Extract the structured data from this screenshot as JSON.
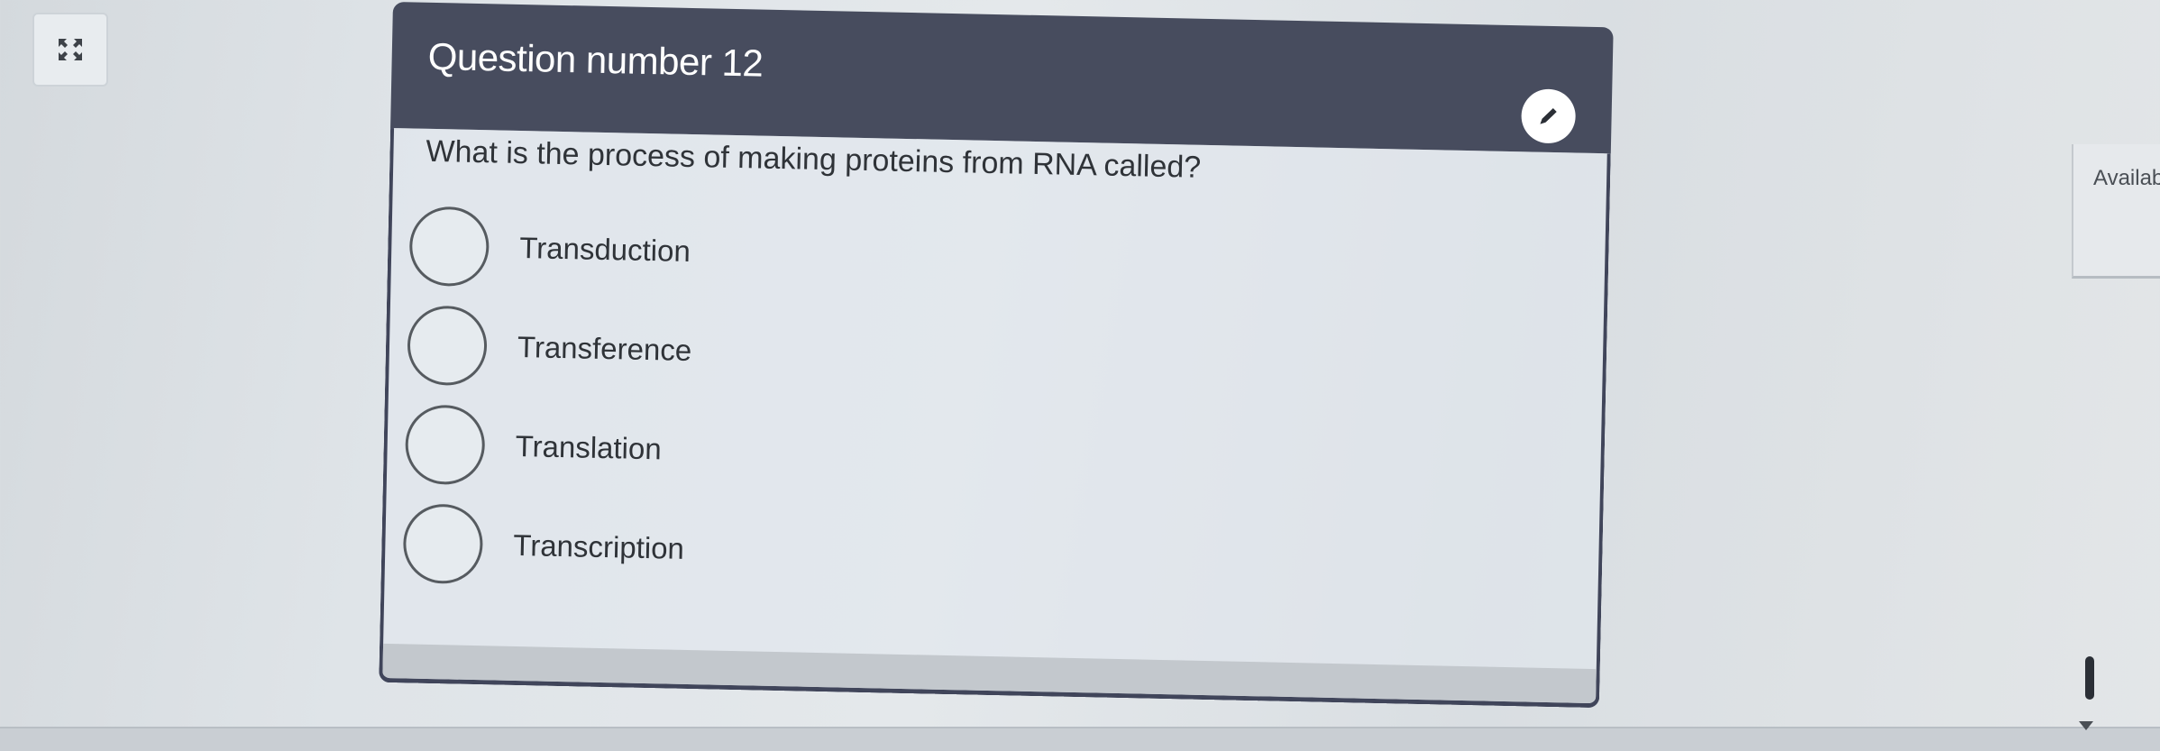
{
  "expand": {
    "icon": "expand-icon"
  },
  "question": {
    "header": "Question number 12",
    "edit_icon": "pencil-icon",
    "prompt": "What is the process of making proteins from RNA called?",
    "options": [
      {
        "label": "Transduction",
        "selected": false
      },
      {
        "label": "Transference",
        "selected": false
      },
      {
        "label": "Translation",
        "selected": false
      },
      {
        "label": "Transcription",
        "selected": false
      }
    ]
  },
  "side_panel": {
    "label": "Availab"
  },
  "colors": {
    "header_bg": "#474c5e",
    "border": "#40455a",
    "text": "#2f3338"
  }
}
